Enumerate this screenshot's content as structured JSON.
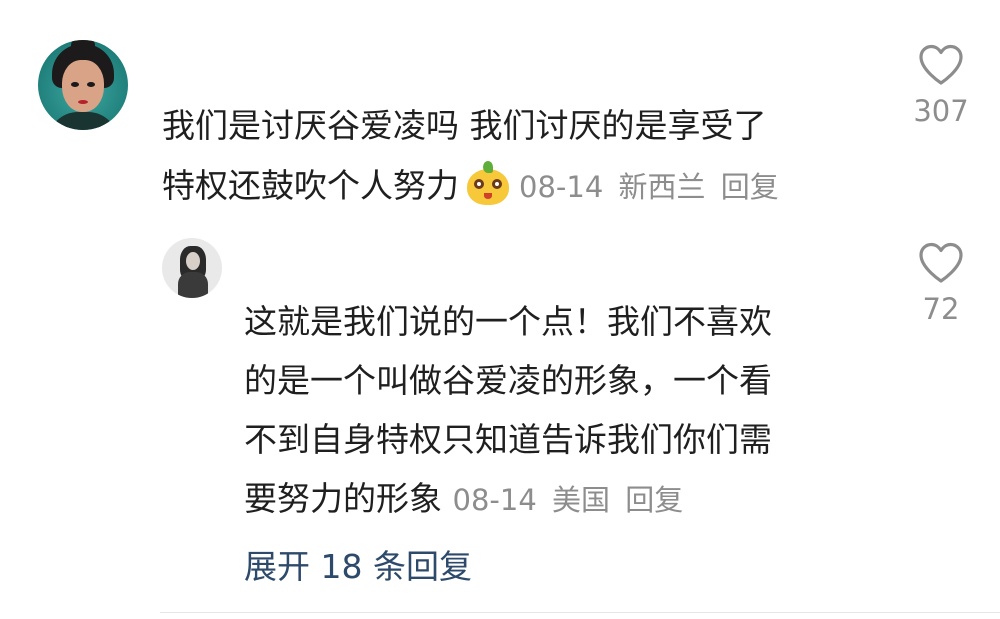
{
  "comment": {
    "text_line1": "我们是讨厌谷爱凌吗 我们讨厌的是享受了",
    "text_line2": "特权还鼓吹个人努力",
    "date": "08-14",
    "location": "新西兰",
    "reply_label": "回复",
    "likes": "307"
  },
  "reply": {
    "text_line1": "这就是我们说的一个点！我们不喜欢",
    "text_line2": "的是一个叫做谷爱凌的形象，一个看",
    "text_line3": "不到自身特权只知道告诉我们你们需",
    "text_line4": "要努力的形象",
    "date": "08-14",
    "location": "美国",
    "reply_label": "回复",
    "likes": "72"
  },
  "expand_label": "展开 18 条回复",
  "icons": {
    "like": "heart-outline-icon",
    "emoji": "yellow-face-emoji-icon"
  },
  "colors": {
    "text": "#1f1f1f",
    "meta": "#8d8d8d",
    "link": "#2e4a6b"
  }
}
